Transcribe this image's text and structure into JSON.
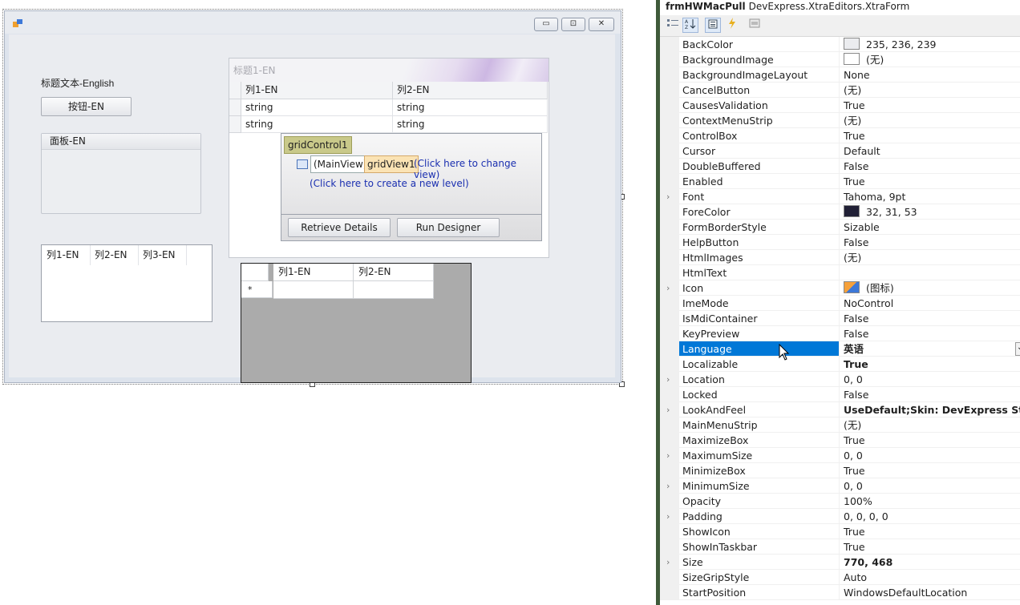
{
  "designer": {
    "label_text": "标题文本-English",
    "button_text": "按钮-EN",
    "panel_caption": "面板-EN",
    "list_columns": [
      "列1-EN",
      "列2-EN",
      "列3-EN"
    ],
    "caption_buttons": {
      "minimize": "▭",
      "maximize": "⊡",
      "close": "✕"
    },
    "group_caption": "标题1-EN",
    "grid1": {
      "columns": [
        "列1-EN",
        "列2-EN"
      ],
      "rows": [
        [
          "string",
          "string"
        ],
        [
          "string",
          "string"
        ]
      ]
    },
    "level_designer": {
      "grid_control": "gridControl1",
      "main_view": "(MainView)",
      "grid_view": "gridView1",
      "change_view_link": "(Click here to change view)",
      "new_level_link": "(Click here to create a new level)",
      "retrieve_button": "Retrieve Details",
      "designer_button": "Run Designer"
    },
    "grid2": {
      "columns": [
        "列1-EN",
        "列2-EN"
      ],
      "new_row_marker": "*"
    }
  },
  "property_grid": {
    "object_name": "frmHWMacPull",
    "object_type": "DevExpress.XtraEditors.XtraForm",
    "toolbar_icons": [
      "categorized-icon",
      "alphabetical-icon",
      "properties-icon",
      "events-icon",
      "property-pages-icon"
    ],
    "selected": "Language",
    "rows": [
      {
        "name": "BackColor",
        "value": "235, 236, 239",
        "swatch": "#ebecef"
      },
      {
        "name": "BackgroundImage",
        "value": "(无)",
        "swatch": "#ffffff"
      },
      {
        "name": "BackgroundImageLayout",
        "value": "None"
      },
      {
        "name": "CancelButton",
        "value": "(无)"
      },
      {
        "name": "CausesValidation",
        "value": "True"
      },
      {
        "name": "ContextMenuStrip",
        "value": "(无)"
      },
      {
        "name": "ControlBox",
        "value": "True"
      },
      {
        "name": "Cursor",
        "value": "Default"
      },
      {
        "name": "DoubleBuffered",
        "value": "False"
      },
      {
        "name": "Enabled",
        "value": "True"
      },
      {
        "name": "Font",
        "value": "Tahoma, 9pt",
        "expandable": true
      },
      {
        "name": "ForeColor",
        "value": "32, 31, 53",
        "swatch": "#201f35"
      },
      {
        "name": "FormBorderStyle",
        "value": "Sizable"
      },
      {
        "name": "HelpButton",
        "value": "False"
      },
      {
        "name": "HtmlImages",
        "value": "(无)"
      },
      {
        "name": "HtmlText",
        "value": ""
      },
      {
        "name": "Icon",
        "value": "(图标)",
        "expandable": true,
        "icon": true
      },
      {
        "name": "ImeMode",
        "value": "NoControl"
      },
      {
        "name": "IsMdiContainer",
        "value": "False"
      },
      {
        "name": "KeyPreview",
        "value": "False"
      },
      {
        "name": "Language",
        "value": "英语",
        "bold": true,
        "dropdown": true
      },
      {
        "name": "Localizable",
        "value": "True",
        "bold": true
      },
      {
        "name": "Location",
        "value": "0, 0",
        "expandable": true
      },
      {
        "name": "Locked",
        "value": "False"
      },
      {
        "name": "LookAndFeel",
        "value": "UseDefault;Skin: DevExpress Style",
        "expandable": true,
        "bold": true
      },
      {
        "name": "MainMenuStrip",
        "value": "(无)"
      },
      {
        "name": "MaximizeBox",
        "value": "True"
      },
      {
        "name": "MaximumSize",
        "value": "0, 0",
        "expandable": true
      },
      {
        "name": "MinimizeBox",
        "value": "True"
      },
      {
        "name": "MinimumSize",
        "value": "0, 0",
        "expandable": true
      },
      {
        "name": "Opacity",
        "value": "100%"
      },
      {
        "name": "Padding",
        "value": "0, 0, 0, 0",
        "expandable": true
      },
      {
        "name": "ShowIcon",
        "value": "True"
      },
      {
        "name": "ShowInTaskbar",
        "value": "True"
      },
      {
        "name": "Size",
        "value": "770, 468",
        "expandable": true,
        "bold": true
      },
      {
        "name": "SizeGripStyle",
        "value": "Auto"
      },
      {
        "name": "StartPosition",
        "value": "WindowsDefaultLocation"
      }
    ]
  }
}
